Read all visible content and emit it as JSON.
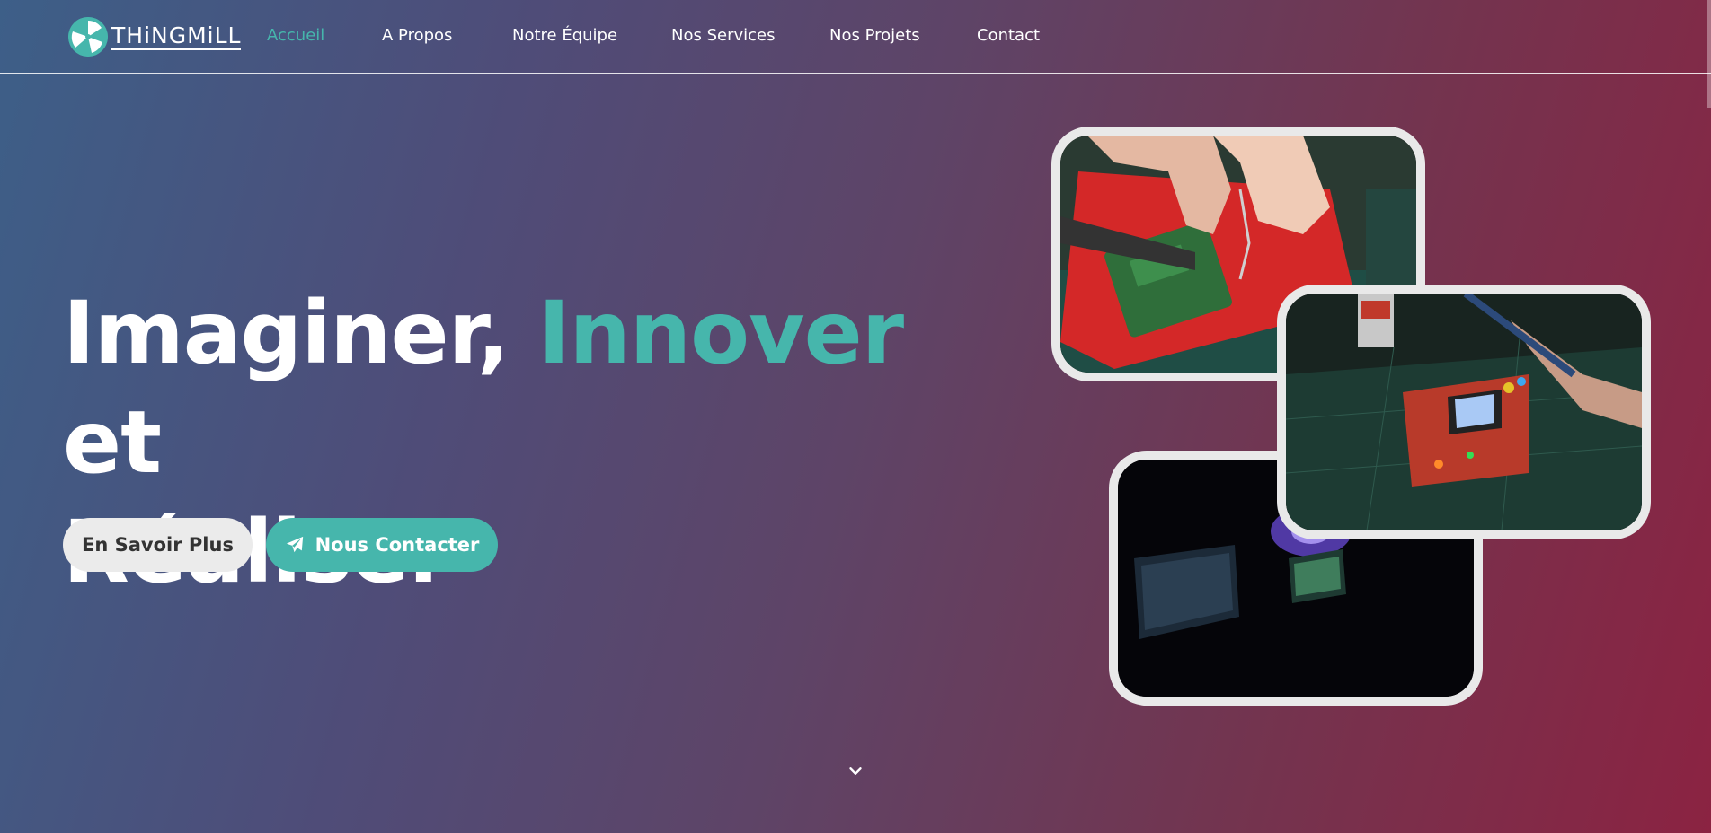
{
  "brand": {
    "name": "THiNGMiLL",
    "logo_icon": "fan-logo-icon"
  },
  "nav": {
    "items": [
      {
        "label": "Accueil",
        "active": true
      },
      {
        "label": "A Propos",
        "active": false
      },
      {
        "label": "Notre Équipe",
        "active": false
      },
      {
        "label": "Nos Services",
        "active": false
      },
      {
        "label": "Nos Projets",
        "active": false
      },
      {
        "label": "Contact",
        "active": false
      }
    ]
  },
  "hero": {
    "title_part1": "Imaginer, ",
    "title_accent": "Innover",
    "title_part2": " et",
    "title_line2": "Réaliser",
    "btn_more": "En Savoir Plus",
    "btn_contact": "Nous Contacter",
    "btn_contact_icon": "paper-plane-icon"
  },
  "photos": [
    {
      "subject": "soldering-board-photo"
    },
    {
      "subject": "handheld-console-photo"
    },
    {
      "subject": "dark-workstation-photo"
    }
  ],
  "scroll_icon": "chevron-down-icon",
  "colors": {
    "accent": "#46b6ac",
    "gradient_start": "#3d5f88",
    "gradient_end": "#8b2342",
    "button_light": "#ebebeb",
    "photo_border": "#e9e9e9"
  }
}
